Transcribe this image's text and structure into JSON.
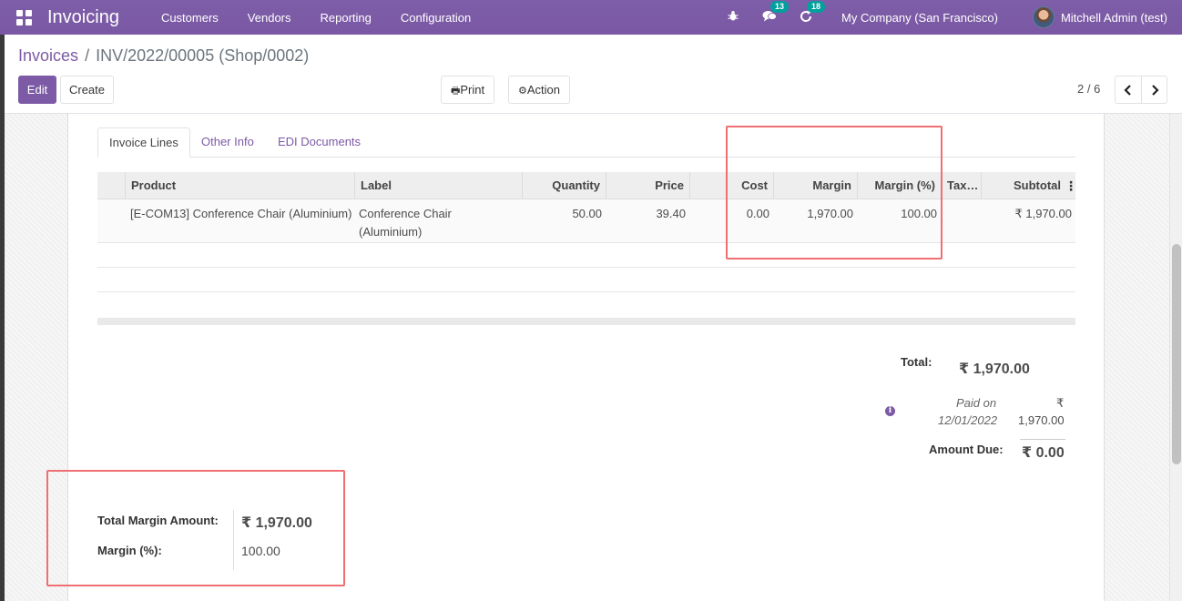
{
  "navbar": {
    "app_name": "Invoicing",
    "menu": [
      "Customers",
      "Vendors",
      "Reporting",
      "Configuration"
    ],
    "messages_count": "13",
    "activities_count": "18",
    "company": "My Company (San Francisco)",
    "user": "Mitchell Admin (test)",
    "accent_color": "#7c5aa6"
  },
  "breadcrumb": {
    "parent": "Invoices",
    "separator": "/",
    "current": "INV/2022/00005 (Shop/0002)"
  },
  "toolbar": {
    "edit_label": "Edit",
    "create_label": "Create",
    "print_label": "Print",
    "action_label": "Action",
    "pager": "2 / 6"
  },
  "tabs": [
    "Invoice Lines",
    "Other Info",
    "EDI Documents"
  ],
  "table": {
    "headers": [
      "Product",
      "Label",
      "Quantity",
      "Price",
      "Cost",
      "Margin",
      "Margin (%)",
      "Tax…",
      "Subtotal"
    ],
    "row": {
      "product": "[E-COM13] Conference Chair (Aluminium)",
      "label_line1": "Conference Chair",
      "label_line2": "(Aluminium)",
      "quantity": "50.00",
      "price": "39.40",
      "cost": "0.00",
      "margin": "1,970.00",
      "margin_pct": "100.00",
      "subtotal": "₹ 1,970.00"
    }
  },
  "totals": {
    "total_label": "Total:",
    "total_value": "₹ 1,970.00",
    "paid_on_label": "Paid on",
    "paid_date": "12/01/2022",
    "paid_currency": "₹",
    "paid_amount": "1,970.00",
    "amount_due_label": "Amount Due:",
    "amount_due_value": "₹ 0.00"
  },
  "margin_summary": {
    "total_margin_label": "Total Margin Amount:",
    "total_margin_value": "₹ 1,970.00",
    "margin_pct_label": "Margin (%):",
    "margin_pct_value": "100.00"
  },
  "highlight_color": "#ef6f72"
}
